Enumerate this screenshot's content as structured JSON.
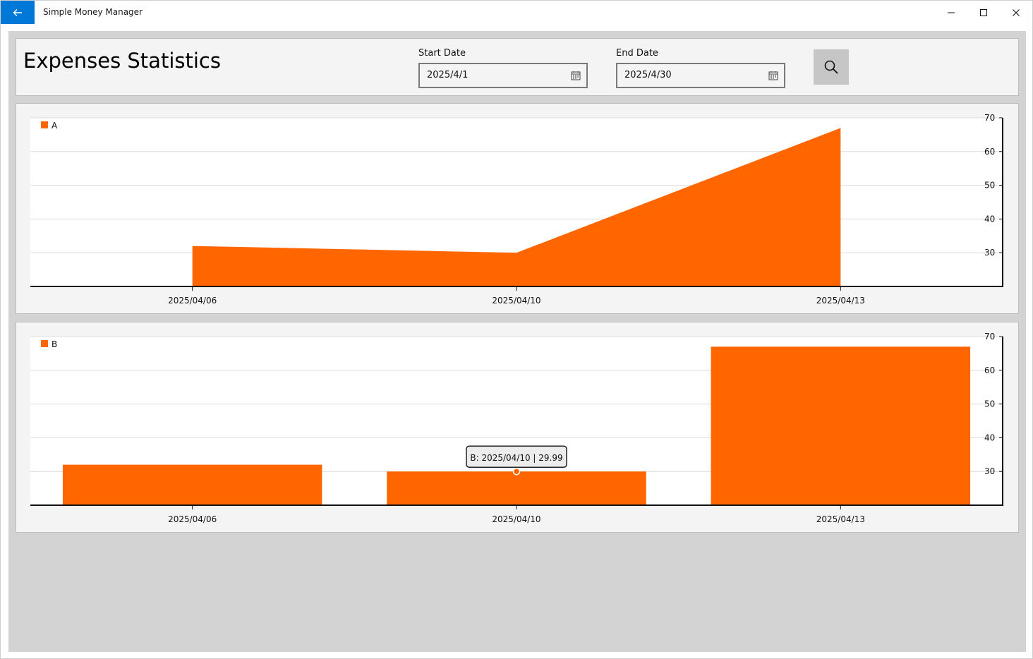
{
  "window": {
    "title": "Simple Money Manager"
  },
  "header": {
    "page_title": "Expenses Statistics",
    "start_date_label": "Start Date",
    "start_date_value": "2025/4/1",
    "end_date_label": "End Date",
    "end_date_value": "2025/4/30"
  },
  "colors": {
    "accent": "#0078d7",
    "series": "#ff6600",
    "panel": "#f4f4f4",
    "background": "#d3d3d3"
  },
  "icons": {
    "back": "back-arrow-icon",
    "minimize": "minimize-icon",
    "maximize": "maximize-icon",
    "close": "close-icon",
    "calendar": "calendar-icon",
    "search": "search-icon"
  },
  "chart_data": [
    {
      "type": "area",
      "categories": [
        "2025/04/06",
        "2025/04/10",
        "2025/04/13"
      ],
      "series": [
        {
          "name": "A",
          "values": [
            32.0,
            29.99,
            67.0
          ]
        }
      ],
      "y_ticks": [
        "30",
        "40",
        "50",
        "60",
        "70"
      ],
      "ylim": [
        20,
        70
      ],
      "grid": true,
      "legend_position": "top-left",
      "y_axis_side": "right"
    },
    {
      "type": "bar",
      "categories": [
        "2025/04/06",
        "2025/04/10",
        "2025/04/13"
      ],
      "series": [
        {
          "name": "B",
          "values": [
            32.0,
            29.99,
            67.0
          ]
        }
      ],
      "y_ticks": [
        "30",
        "40",
        "50",
        "60",
        "70"
      ],
      "ylim": [
        20,
        70
      ],
      "grid": true,
      "legend_position": "top-left",
      "y_axis_side": "right",
      "tooltip": {
        "text": "B: 2025/04/10 | 29.99",
        "category_index": 1
      }
    }
  ]
}
